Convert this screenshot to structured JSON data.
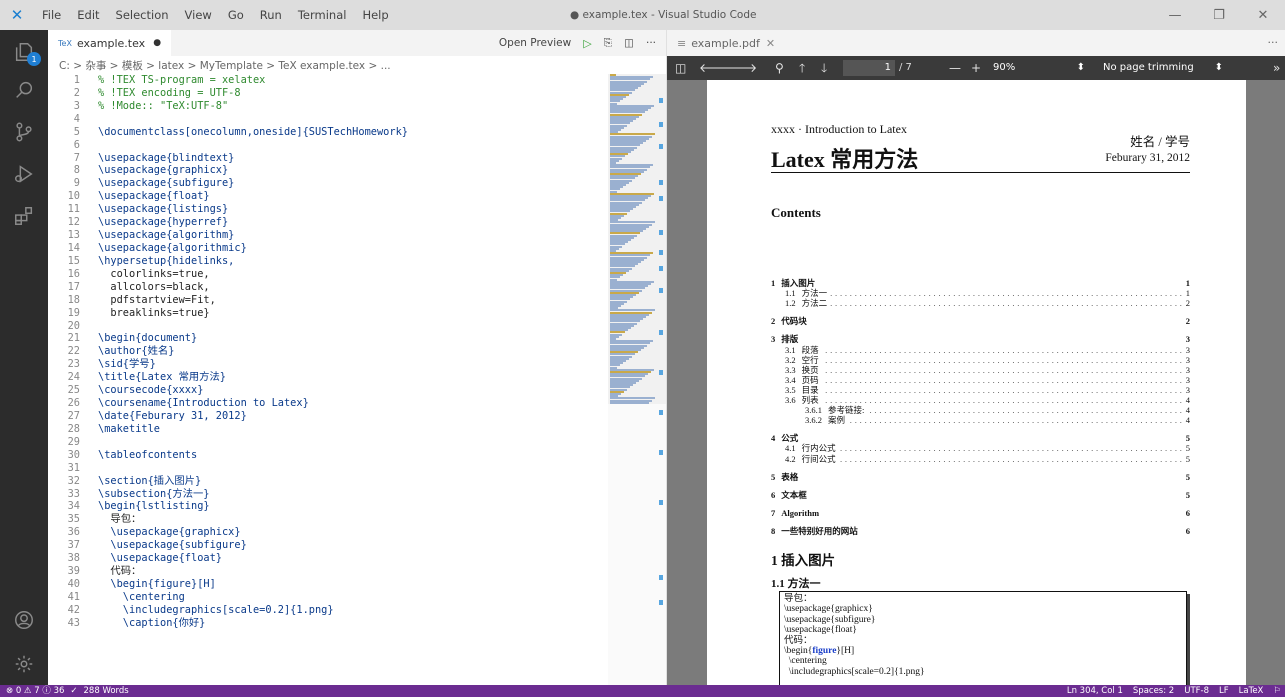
{
  "titlebar": {
    "menu": [
      "File",
      "Edit",
      "Selection",
      "View",
      "Go",
      "Run",
      "Terminal",
      "Help"
    ],
    "window_title": "● example.tex - Visual Studio Code"
  },
  "activity": {
    "badge": "1"
  },
  "editor": {
    "tab_label": "example.tex",
    "tab_icon": "TeX",
    "open_preview": "Open Preview",
    "breadcrumb": "C: > 杂事 > 模板 > latex > MyTemplate > TeX example.tex > ...",
    "lines": [
      {
        "n": "1",
        "t": "% !TEX TS-program = xelatex",
        "k": "cmt"
      },
      {
        "n": "2",
        "t": "% !TEX encoding = UTF-8",
        "k": "cmt"
      },
      {
        "n": "3",
        "t": "% !Mode:: \"TeX:UTF-8\"",
        "k": "cmt"
      },
      {
        "n": "4",
        "t": "",
        "k": "plain"
      },
      {
        "n": "5",
        "t": "\\documentclass[onecolumn,oneside]{SUSTechHomework}",
        "k": "cmd"
      },
      {
        "n": "6",
        "t": "",
        "k": "plain"
      },
      {
        "n": "7",
        "t": "\\usepackage{blindtext}",
        "k": "cmd"
      },
      {
        "n": "8",
        "t": "\\usepackage{graphicx}",
        "k": "cmd"
      },
      {
        "n": "9",
        "t": "\\usepackage{subfigure}",
        "k": "cmd"
      },
      {
        "n": "10",
        "t": "\\usepackage{float}",
        "k": "cmd"
      },
      {
        "n": "11",
        "t": "\\usepackage{listings}",
        "k": "cmd"
      },
      {
        "n": "12",
        "t": "\\usepackage{hyperref}",
        "k": "cmd"
      },
      {
        "n": "13",
        "t": "\\usepackage{algorithm}",
        "k": "cmd"
      },
      {
        "n": "14",
        "t": "\\usepackage{algorithmic}",
        "k": "cmd"
      },
      {
        "n": "15",
        "t": "\\hypersetup{hidelinks,",
        "k": "cmd"
      },
      {
        "n": "16",
        "t": "  colorlinks=true,",
        "k": "plain"
      },
      {
        "n": "17",
        "t": "  allcolors=black,",
        "k": "plain"
      },
      {
        "n": "18",
        "t": "  pdfstartview=Fit,",
        "k": "plain"
      },
      {
        "n": "19",
        "t": "  breaklinks=true}",
        "k": "plain"
      },
      {
        "n": "20",
        "t": "",
        "k": "plain"
      },
      {
        "n": "21",
        "t": "\\begin{document}",
        "k": "cmd"
      },
      {
        "n": "22",
        "t": "\\author{姓名}",
        "k": "cmd"
      },
      {
        "n": "23",
        "t": "\\sid{学号}",
        "k": "cmd"
      },
      {
        "n": "24",
        "t": "\\title{Latex 常用方法}",
        "k": "cmd"
      },
      {
        "n": "25",
        "t": "\\coursecode{xxxx}",
        "k": "cmd"
      },
      {
        "n": "26",
        "t": "\\coursename{Introduction to Latex}",
        "k": "cmd"
      },
      {
        "n": "27",
        "t": "\\date{Feburary 31, 2012}",
        "k": "cmd"
      },
      {
        "n": "28",
        "t": "\\maketitle",
        "k": "cmd"
      },
      {
        "n": "29",
        "t": "",
        "k": "plain"
      },
      {
        "n": "30",
        "t": "\\tableofcontents",
        "k": "cmd"
      },
      {
        "n": "31",
        "t": "",
        "k": "plain"
      },
      {
        "n": "32",
        "t": "\\section{插入图片}",
        "k": "cmd"
      },
      {
        "n": "33",
        "t": "\\subsection{方法一}",
        "k": "cmd"
      },
      {
        "n": "34",
        "t": "\\begin{lstlisting}",
        "k": "cmd"
      },
      {
        "n": "35",
        "t": "  导包：",
        "k": "plain"
      },
      {
        "n": "36",
        "t": "  \\usepackage{graphicx}",
        "k": "cmd"
      },
      {
        "n": "37",
        "t": "  \\usepackage{subfigure}",
        "k": "cmd"
      },
      {
        "n": "38",
        "t": "  \\usepackage{float}",
        "k": "cmd"
      },
      {
        "n": "39",
        "t": "  代码：",
        "k": "plain"
      },
      {
        "n": "40",
        "t": "  \\begin{figure}[H]",
        "k": "cmd"
      },
      {
        "n": "41",
        "t": "    \\centering",
        "k": "cmd"
      },
      {
        "n": "42",
        "t": "    \\includegraphics[scale=0.2]{1.png}",
        "k": "cmd"
      },
      {
        "n": "43",
        "t": "    \\caption{你好}",
        "k": "cmd"
      }
    ]
  },
  "pdf": {
    "tab_label": "example.pdf",
    "page_input": "1",
    "page_count": "/ 7",
    "zoom": "90%",
    "trim": "No page trimming",
    "course": "xxxx · Introduction to Latex",
    "name_sid": "姓名 / 学号",
    "title": "Latex 常用方法",
    "date": "Feburary 31, 2012",
    "contents_heading": "Contents",
    "toc": [
      {
        "num": "1",
        "text": "插入图片",
        "page": "1",
        "bold": true,
        "indent": 0,
        "dots": false,
        "gap": 0
      },
      {
        "num": "1.1",
        "text": "方法一",
        "page": "1",
        "bold": false,
        "indent": 14,
        "dots": true,
        "gap": 0
      },
      {
        "num": "1.2",
        "text": "方法二",
        "page": "2",
        "bold": false,
        "indent": 14,
        "dots": true,
        "gap": 0
      },
      {
        "num": "2",
        "text": "代码块",
        "page": "2",
        "bold": true,
        "indent": 0,
        "dots": false,
        "gap": 8
      },
      {
        "num": "3",
        "text": "排版",
        "page": "3",
        "bold": true,
        "indent": 0,
        "dots": false,
        "gap": 8
      },
      {
        "num": "3.1",
        "text": "段落",
        "page": "3",
        "bold": false,
        "indent": 14,
        "dots": true,
        "gap": 0
      },
      {
        "num": "3.2",
        "text": "空行",
        "page": "3",
        "bold": false,
        "indent": 14,
        "dots": true,
        "gap": 0
      },
      {
        "num": "3.3",
        "text": "换页",
        "page": "3",
        "bold": false,
        "indent": 14,
        "dots": true,
        "gap": 0
      },
      {
        "num": "3.4",
        "text": "页码",
        "page": "3",
        "bold": false,
        "indent": 14,
        "dots": true,
        "gap": 0
      },
      {
        "num": "3.5",
        "text": "目录",
        "page": "3",
        "bold": false,
        "indent": 14,
        "dots": true,
        "gap": 0
      },
      {
        "num": "3.6",
        "text": "列表",
        "page": "4",
        "bold": false,
        "indent": 14,
        "dots": true,
        "gap": 0
      },
      {
        "num": "3.6.1",
        "text": "参考链接:",
        "page": "4",
        "bold": false,
        "indent": 34,
        "dots": true,
        "gap": 0
      },
      {
        "num": "3.6.2",
        "text": "案例",
        "page": "4",
        "bold": false,
        "indent": 34,
        "dots": true,
        "gap": 0
      },
      {
        "num": "4",
        "text": "公式",
        "page": "5",
        "bold": true,
        "indent": 0,
        "dots": false,
        "gap": 8
      },
      {
        "num": "4.1",
        "text": "行内公式",
        "page": "5",
        "bold": false,
        "indent": 14,
        "dots": true,
        "gap": 0
      },
      {
        "num": "4.2",
        "text": "行间公式",
        "page": "5",
        "bold": false,
        "indent": 14,
        "dots": true,
        "gap": 0
      },
      {
        "num": "5",
        "text": "表格",
        "page": "5",
        "bold": true,
        "indent": 0,
        "dots": false,
        "gap": 8
      },
      {
        "num": "6",
        "text": "文本框",
        "page": "5",
        "bold": true,
        "indent": 0,
        "dots": false,
        "gap": 8
      },
      {
        "num": "7",
        "text": "Algorithm",
        "page": "6",
        "bold": true,
        "indent": 0,
        "dots": false,
        "gap": 8
      },
      {
        "num": "8",
        "text": "一些特别好用的网站",
        "page": "6",
        "bold": true,
        "indent": 0,
        "dots": false,
        "gap": 8
      }
    ],
    "section1": "1  插入图片",
    "subsection11": "1.1  方法一",
    "listing": [
      "导包：",
      "\\usepackage{graphicx}",
      "\\usepackage{subfigure}",
      "\\usepackage{float}",
      "代码：",
      "\\begin{figure}[H]",
      "  \\centering",
      "  \\includegraphics[scale=0.2]{1.png}"
    ],
    "listing_kw": "figure"
  },
  "status": {
    "problems": "⊗ 0 ⚠ 7 ⓘ 36",
    "check": "✓",
    "words": "288 Words",
    "position": "Ln 304, Col 1",
    "spaces": "Spaces: 2",
    "encoding": "UTF-8",
    "eol": "LF",
    "language": "LaTeX"
  },
  "colors": {
    "statusbar": "#6b2c91",
    "activitybar": "#2c2c2c",
    "accent": "#1f7fd4"
  }
}
